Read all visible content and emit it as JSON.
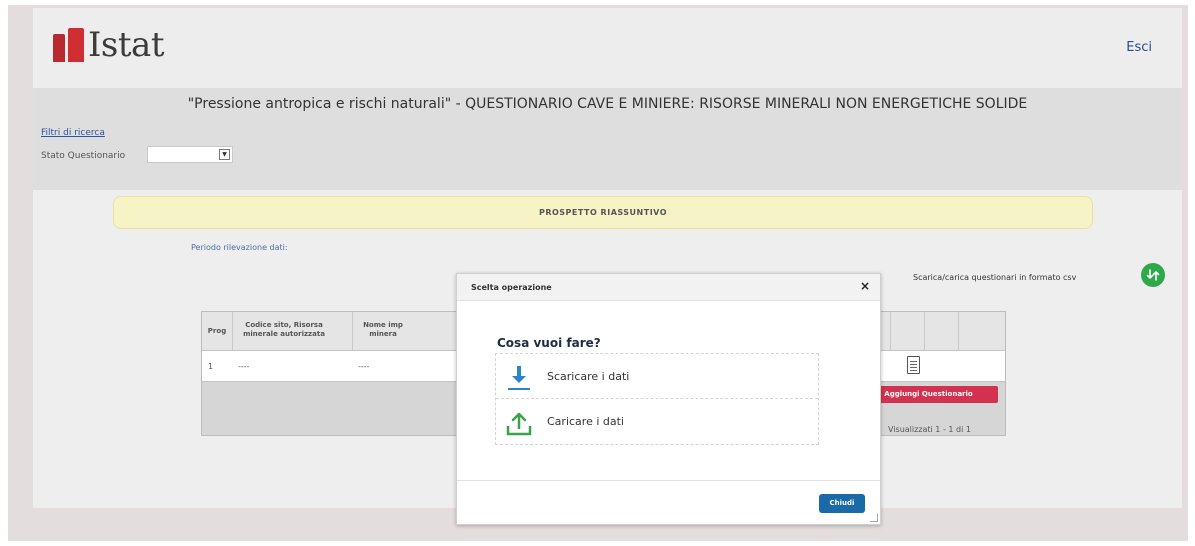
{
  "header": {
    "logo_text": "Istat",
    "logout_label": "Esci"
  },
  "title_bar": {
    "title": "\"Pressione antropica e rischi naturali\" - QUESTIONARIO CAVE E MINIERE: RISORSE MINERALI NON ENERGETICHE SOLIDE",
    "filters_link": "Filtri di ricerca",
    "status_label": "Stato Questionario",
    "status_value": ""
  },
  "summary": {
    "banner": "PROSPETTO RIASSUNTIVO",
    "period_label": "Periodo rilevazione dati:",
    "csv_label": "Scarica/carica questionari in formato csv"
  },
  "grid": {
    "columns": [
      "Prog",
      "Codice sito, Risorsa minerale autorizzata",
      "Nome imp minera"
    ],
    "rows": [
      {
        "prog": "1",
        "codice": "----",
        "nome": "----"
      }
    ],
    "add_button": "Aggiungi Questionario",
    "pager": "Visualizzati 1 - 1 di 1"
  },
  "modal": {
    "title": "Scelta operazione",
    "question": "Cosa vuoi fare?",
    "options": [
      {
        "label": "Scaricare i dati",
        "icon": "download-arrow-icon"
      },
      {
        "label": "Caricare i dati",
        "icon": "upload-arrow-icon"
      }
    ],
    "close_button": "Chiudi"
  },
  "colors": {
    "brand_red": "#cf2e33",
    "banner_yellow": "#f6f3c6",
    "add_button_red": "#d2324f",
    "close_button_blue": "#1a6aa8",
    "csv_green": "#2fa84a",
    "download_blue": "#2b86c9",
    "upload_green": "#3aa14c"
  }
}
